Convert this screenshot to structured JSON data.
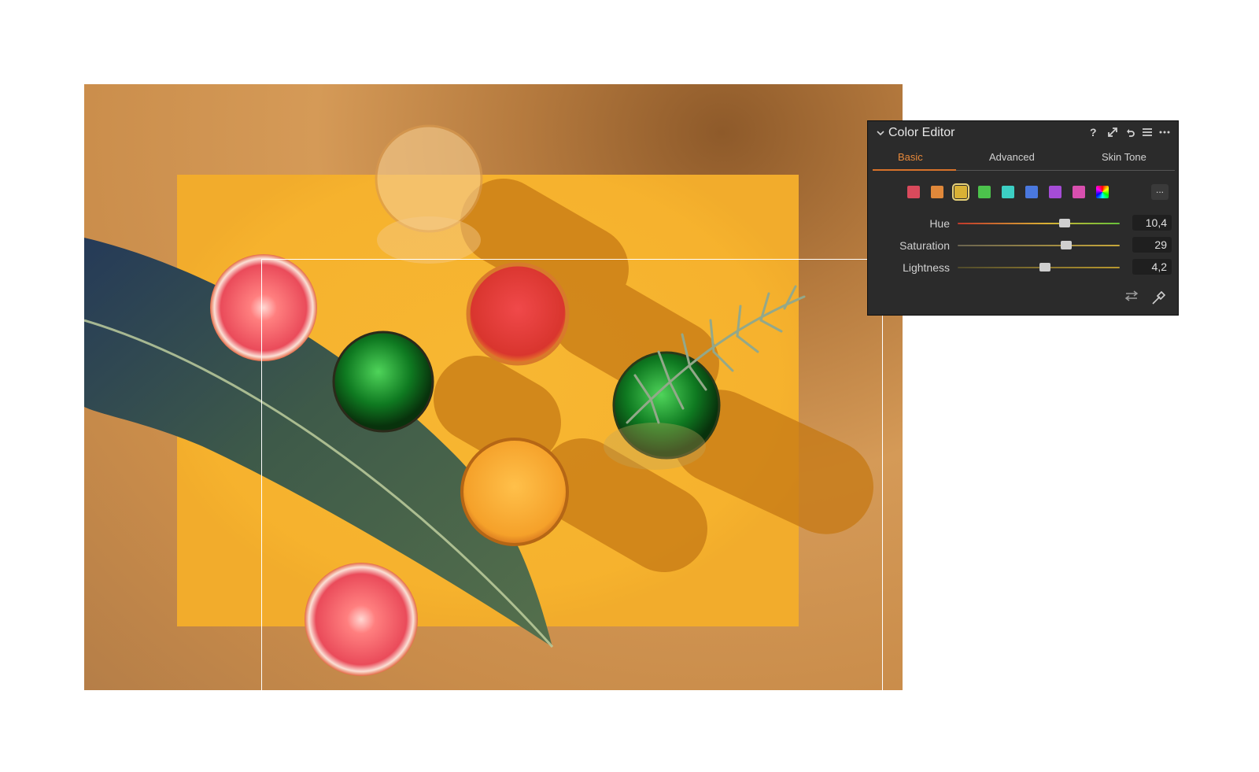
{
  "panel": {
    "title": "Color Editor",
    "help_glyph": "?",
    "tabs": [
      {
        "label": "Basic",
        "active": true
      },
      {
        "label": "Advanced",
        "active": false
      },
      {
        "label": "Skin Tone",
        "active": false
      }
    ],
    "swatches": [
      {
        "name": "red",
        "color": "#d94a5c"
      },
      {
        "name": "orange",
        "color": "#e0883a"
      },
      {
        "name": "yellow",
        "color": "#d9b135",
        "selected": true
      },
      {
        "name": "green",
        "color": "#4cc24c"
      },
      {
        "name": "aqua",
        "color": "#3ccfc4"
      },
      {
        "name": "blue",
        "color": "#4a78de"
      },
      {
        "name": "purple",
        "color": "#a54cd6"
      },
      {
        "name": "magenta",
        "color": "#d84fae"
      },
      {
        "name": "all",
        "color": "rainbow"
      }
    ],
    "more_label": "...",
    "sliders": [
      {
        "label": "Hue",
        "value": "10,4",
        "level": 0.66,
        "track": "linear-gradient(90deg,#c0392b,#d9b135 55%,#67c23a)"
      },
      {
        "label": "Saturation",
        "value": "29",
        "level": 0.67,
        "track": "linear-gradient(90deg,#6a6450,#c7a73a)"
      },
      {
        "label": "Lightness",
        "value": "4,2",
        "level": 0.54,
        "track": "linear-gradient(90deg,#4f4a2c,#b8982f)"
      }
    ],
    "icons": {
      "collapse": "chevron-down-icon",
      "help": "help-icon",
      "expand": "expand-icon",
      "reset": "reset-icon",
      "menu": "menu-icon",
      "more": "more-icon",
      "adjust": "adjust-icon",
      "picker": "color-picker-icon"
    },
    "accent": "#e8893a"
  },
  "photo": {
    "background_color": "#d59a57",
    "highlight_color": "#f6b52e"
  }
}
